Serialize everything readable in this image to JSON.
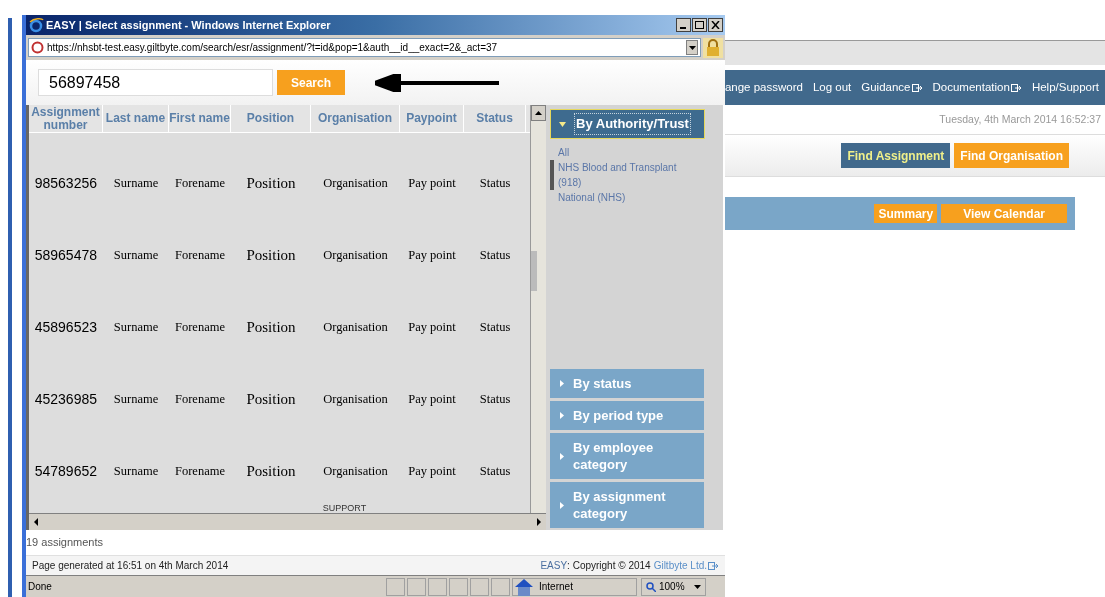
{
  "window": {
    "title": "EASY | Select assignment - Windows Internet Explorer",
    "address": "https://nhsbt-test.easy.giltbyte.com/search/esr/assignment/?t=id&pop=1&auth__id__exact=2&_act=37"
  },
  "search": {
    "value": "56897458",
    "button": "Search"
  },
  "table": {
    "columns": [
      "Assignment number",
      "Last name",
      "First name",
      "Position",
      "Organisation",
      "Paypoint",
      "Status"
    ],
    "rows": [
      [
        "98563256",
        "Surname",
        "Forename",
        "Position",
        "Organisation",
        "Pay point",
        "Status"
      ],
      [
        "58965478",
        "Surname",
        "Forename",
        "Position",
        "Organisation",
        "Pay point",
        "Status"
      ],
      [
        "45896523",
        "Surname",
        "Forename",
        "Position",
        "Organisation",
        "Pay point",
        "Status"
      ],
      [
        "45236985",
        "Surname",
        "Forename",
        "Position",
        "Organisation",
        "Pay point",
        "Status"
      ],
      [
        "54789652",
        "Surname",
        "Forename",
        "Position",
        "Organisation",
        "Pay point",
        "Status"
      ]
    ],
    "cut_text": "SUPPORT"
  },
  "filters": [
    {
      "label": "By Authority/Trust",
      "expanded": true,
      "items": [
        {
          "label": "All",
          "selected": false
        },
        {
          "label": "NHS Blood and Transplant (918)",
          "selected": true
        },
        {
          "label": "National (NHS)",
          "selected": false
        }
      ]
    },
    {
      "label": "By status",
      "expanded": false
    },
    {
      "label": "By period type",
      "expanded": false
    },
    {
      "label": "By employee category",
      "expanded": false
    },
    {
      "label": "By assignment category",
      "expanded": false
    }
  ],
  "result_count": "19 assignments",
  "footer": {
    "generated": "Page generated at 16:51 on 4th March 2014",
    "brand": "EASY",
    "copyright": ": Copyright © 2014",
    "company": "Giltbyte Ltd."
  },
  "status_bar": {
    "text": "Done",
    "zone": "Internet",
    "zoom": "100%"
  },
  "background_page": {
    "nav": [
      {
        "label": "ange password",
        "external": false
      },
      {
        "label": "Log out",
        "external": false
      },
      {
        "label": "Guidance",
        "external": true
      },
      {
        "label": "Documentation",
        "external": true
      },
      {
        "label": "Help/Support",
        "external": false
      }
    ],
    "date": "Tuesday, 4th March 2014 16:52:37",
    "buttons": [
      {
        "label": "Find Assignment",
        "selected": true
      },
      {
        "label": "Find Organisation",
        "selected": false
      }
    ],
    "panel_buttons": [
      "Summary",
      "View Calendar"
    ]
  }
}
